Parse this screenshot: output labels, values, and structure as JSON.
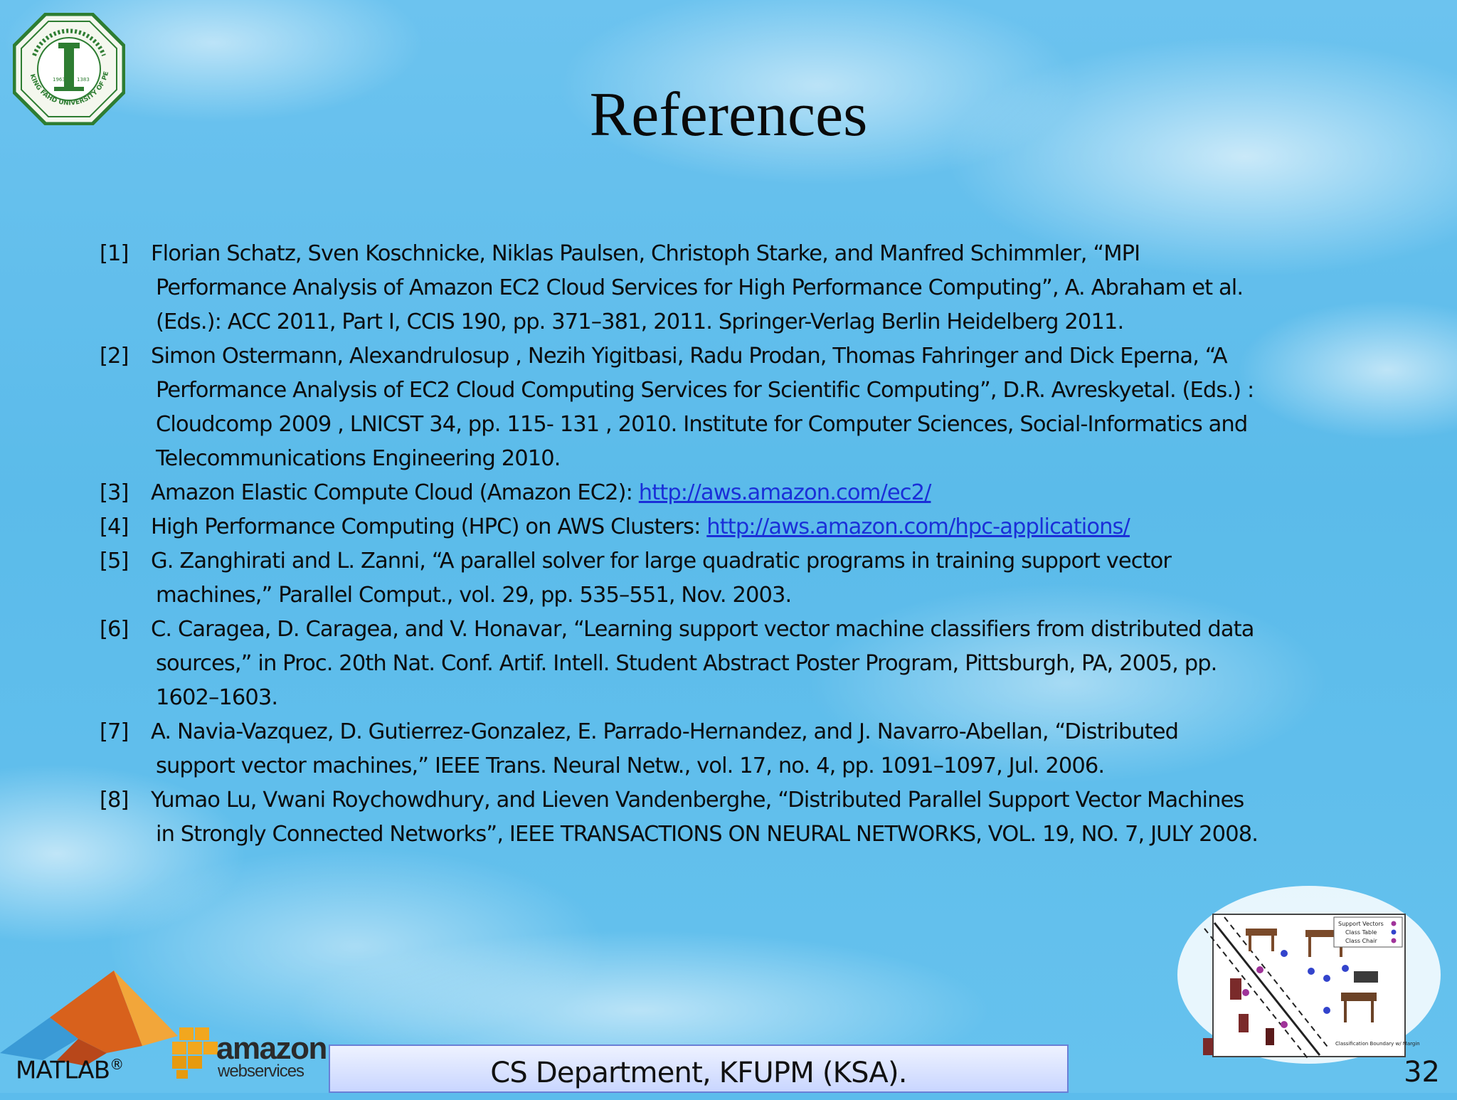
{
  "slide": {
    "title": "References",
    "number": "32"
  },
  "references": [
    {
      "num": "[1]",
      "lines": [
        "Florian Schatz, Sven Koschnicke, Niklas Paulsen, Christoph Starke, and Manfred Schimmler, “MPI",
        "Performance Analysis of Amazon EC2 Cloud Services for High Performance Computing”, A. Abraham et al.",
        "(Eds.): ACC 2011, Part I, CCIS 190, pp. 371–381, 2011. Springer-Verlag Berlin Heidelberg 2011."
      ]
    },
    {
      "num": "[2]",
      "lines": [
        "Simon Ostermann, AlexandruIosup , Nezih Yigitbasi, Radu Prodan, Thomas Fahringer and Dick Eperna, “A",
        "Performance Analysis of EC2 Cloud Computing Services for Scientific Computing”, D.R. Avreskyetal. (Eds.) :",
        "Cloudcomp 2009 , LNICST 34, pp. 115- 131 , 2010. Institute for Computer Sciences, Social-Informatics and",
        "Telecommunications Engineering 2010."
      ]
    },
    {
      "num": "[3]",
      "text": "Amazon Elastic Compute Cloud (Amazon EC2): ",
      "link": "http://aws.amazon.com/ec2/"
    },
    {
      "num": "[4]",
      "text": "High Performance Computing (HPC) on AWS Clusters: ",
      "link": "http://aws.amazon.com/hpc-applications/"
    },
    {
      "num": "[5]",
      "lines": [
        "G. Zanghirati and L. Zanni, “A parallel solver for large quadratic programs in training support vector",
        "machines,” Parallel Comput., vol. 29, pp. 535–551, Nov. 2003."
      ]
    },
    {
      "num": "[6]",
      "lines": [
        "C. Caragea, D. Caragea, and V. Honavar, “Learning support vector machine classifiers from distributed data",
        "sources,” in Proc. 20th Nat. Conf. Artif. Intell. Student Abstract Poster Program, Pittsburgh, PA, 2005, pp.",
        "1602–1603."
      ]
    },
    {
      "num": "[7]",
      "lines": [
        "A. Navia-Vazquez, D. Gutierrez-Gonzalez, E. Parrado-Hernandez, and J. Navarro-Abellan, “Distributed",
        "support vector machines,” IEEE Trans. Neural Netw., vol. 17, no. 4, pp. 1091–1097, Jul. 2006."
      ]
    },
    {
      "num": "[8]",
      "lines": [
        "Yumao Lu, Vwani Roychowdhury, and Lieven Vandenberghe, “Distributed Parallel Support Vector Machines",
        "in Strongly Connected Networks”, IEEE TRANSACTIONS ON NEURAL NETWORKS, VOL. 19, NO. 7, JULY 2008."
      ]
    }
  ],
  "footer": {
    "department": "CS Department, KFUPM (KSA).",
    "matlab_label": "MATLAB",
    "matlab_mark": "®",
    "aws_word": "amazon",
    "aws_sub": "webservices"
  },
  "logos": {
    "university_seal_text": "KING FAHD UNIVERSITY OF PETROLEUM & MINERALS",
    "university_seal_year_left": "1963",
    "university_seal_year_right": "1383",
    "svm_legend": [
      "Support Vectors",
      "Class Table",
      "Class Chair"
    ],
    "svm_caption": "Classification Boundary w/ Margin"
  },
  "colors": {
    "sky": "#5cbcec",
    "link": "#1a2fd8",
    "seal_green": "#2e7d32",
    "footer_border": "#6a7fd6"
  }
}
